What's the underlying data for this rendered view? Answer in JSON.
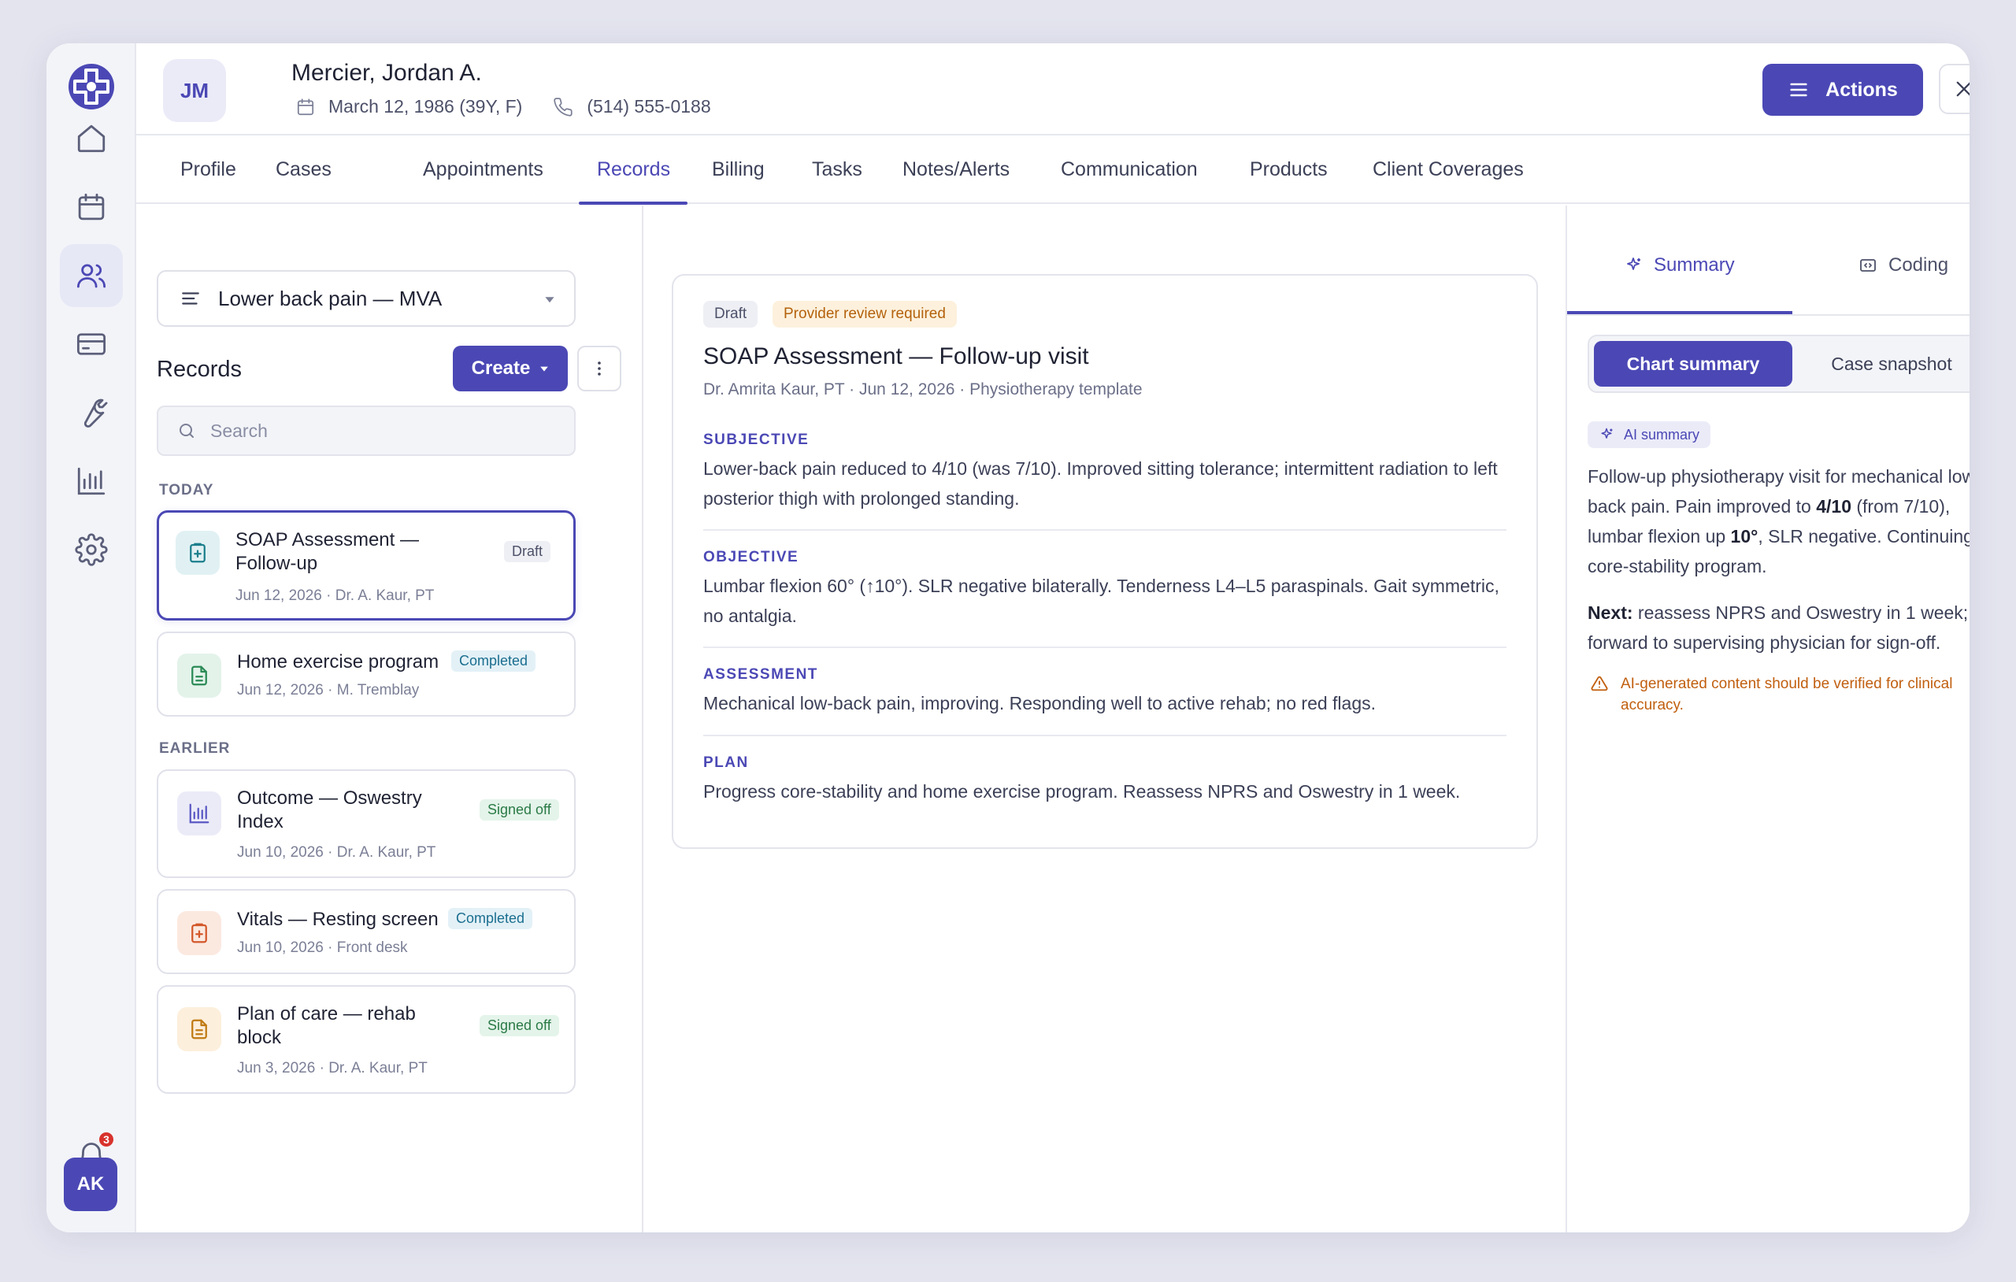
{
  "rail": {
    "logo": "clinic-logo",
    "items": [
      {
        "name": "home",
        "icon": "home-icon"
      },
      {
        "name": "calendar",
        "icon": "calendar-icon"
      },
      {
        "name": "patients",
        "icon": "users-icon",
        "active": true
      },
      {
        "name": "billing",
        "icon": "card-icon"
      },
      {
        "name": "tools",
        "icon": "wrench-icon"
      },
      {
        "name": "reports",
        "icon": "bar-chart-icon"
      },
      {
        "name": "settings",
        "icon": "gear-icon"
      }
    ],
    "notification_count": "3",
    "user_initials": "AK"
  },
  "patient": {
    "initials": "JM",
    "name": "Mercier, Jordan A.",
    "dob": "March 12, 1986 (39Y, F)",
    "phone": "(514) 555-0188"
  },
  "header": {
    "actions_label": "Actions"
  },
  "tabs": [
    {
      "label": "Profile"
    },
    {
      "label": "Cases"
    },
    {
      "label": "Appointments"
    },
    {
      "label": "Records",
      "active": true
    },
    {
      "label": "Billing"
    },
    {
      "label": "Tasks"
    },
    {
      "label": "Notes/Alerts"
    },
    {
      "label": "Communication"
    },
    {
      "label": "Products"
    },
    {
      "label": "Client Coverages"
    }
  ],
  "records": {
    "case_selected": "Lower back pain — MVA",
    "title": "Records",
    "create_label": "Create",
    "search_placeholder": "Search",
    "groups": [
      {
        "label": "TODAY"
      },
      {
        "label": "EARLIER"
      }
    ],
    "items": [
      {
        "title": "SOAP Assessment — Follow-up",
        "meta": "Jun 12, 2026 · Dr. A. Kaur, PT",
        "status": "Draft",
        "icon": "clipboard-plus-icon",
        "color": "#1b7f8c"
      },
      {
        "title": "Home exercise program",
        "meta": "Jun 12, 2026 · M. Tremblay",
        "status": "Completed",
        "icon": "document-icon",
        "color": "#2a8a55"
      },
      {
        "title": "Outcome — Oswestry Index",
        "meta": "Jun 10, 2026 · Dr. A. Kaur, PT",
        "status": "Signed off",
        "icon": "bar-chart-icon",
        "color": "#5b58c4"
      },
      {
        "title": "Vitals — Resting screen",
        "meta": "Jun 10, 2026 · Front desk",
        "status": "Completed",
        "icon": "clipboard-plus-icon",
        "color": "#d3582a"
      },
      {
        "title": "Plan of care — rehab block",
        "meta": "Jun 3, 2026 · Dr. A. Kaur, PT",
        "status": "Signed off",
        "icon": "document-icon",
        "color": "#c07a12"
      }
    ]
  },
  "document": {
    "badge_draft": "Draft",
    "badge_review": "Provider review required",
    "title": "SOAP Assessment — Follow-up visit",
    "subtitle": "Dr. Amrita Kaur, PT · Jun 12, 2026 · Physiotherapy template",
    "sections": [
      {
        "label": "SUBJECTIVE",
        "body": "Lower-back pain reduced to 4/10 (was 7/10). Improved sitting tolerance; intermittent radiation to left posterior thigh with prolonged standing."
      },
      {
        "label": "OBJECTIVE",
        "body": "Lumbar flexion 60° (↑10°). SLR negative bilaterally. Tenderness L4–L5 paraspinals. Gait symmetric, no antalgia."
      },
      {
        "label": "ASSESSMENT",
        "body": "Mechanical low-back pain, improving. Responding well to active rehab; no red flags."
      },
      {
        "label": "PLAN",
        "body": "Progress core-stability and home exercise program. Reassess NPRS and Oswestry in 1 week."
      }
    ]
  },
  "summary_panel": {
    "tab_summary": "Summary",
    "tab_coding": "Coding",
    "seg_chart": "Chart summary",
    "seg_case": "Case snapshot",
    "ai_chip": "AI summary",
    "p1_a": "Follow-up physiotherapy visit for mechanical low-back pain. Pain improved to ",
    "p1_b": "4/10",
    "p1_c": " (from 7/10), lumbar flexion up ",
    "p1_d": "10°",
    "p1_e": ", SLR negative. Continuing core-stability program.",
    "p2_label": "Next:",
    "p2_body": " reassess NPRS and Oswestry in 1 week; forward to supervising physician for sign-off.",
    "warning": "AI-generated content should be verified for clinical accuracy."
  },
  "colors": {
    "accent": "#4b48b5",
    "warning": "#c15f0f",
    "badge_completed": "#1b6e8f",
    "badge_signed": "#2a7a46"
  }
}
